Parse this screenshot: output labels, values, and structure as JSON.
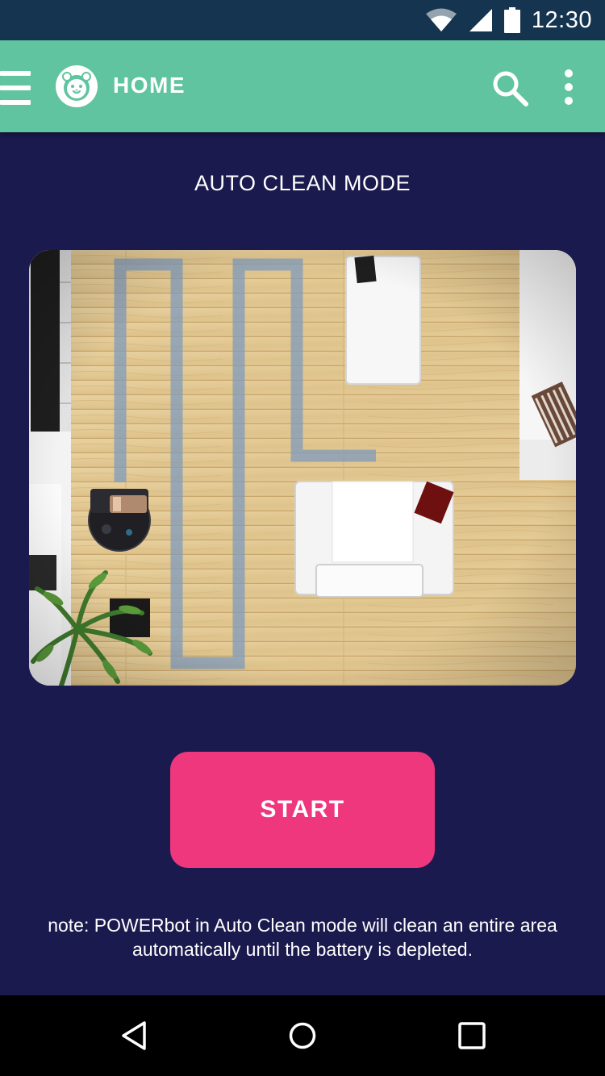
{
  "status_bar": {
    "time": "12:30",
    "icons": [
      "wifi-icon",
      "cellular-signal-icon",
      "battery-icon"
    ]
  },
  "app_bar": {
    "title": "HOME",
    "icons": [
      "menu-icon",
      "lion-logo-icon",
      "search-icon",
      "more-vert-icon"
    ]
  },
  "main": {
    "mode_title": "AUTO CLEAN MODE",
    "start_label": "START",
    "note_line1": "note: POWERbot in Auto Clean mode will clean an entire area",
    "note_line2": "automatically until the battery is depleted."
  },
  "nav_bar": {
    "icons": [
      "back-icon",
      "home-icon",
      "recents-icon"
    ]
  },
  "colors": {
    "status_bar": "#15344f",
    "app_bar": "#5fc49f",
    "background": "#1b1a4e",
    "accent": "#ee377d",
    "nav_bar": "#000000"
  }
}
